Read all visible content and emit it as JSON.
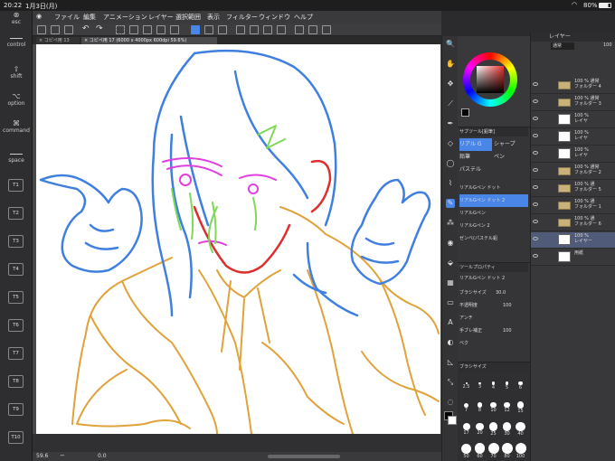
{
  "status": {
    "time": "20:22",
    "date": "1月3日(月)",
    "battery": "80%"
  },
  "menu": [
    "ファイル",
    "編集",
    "アニメーション",
    "レイヤー",
    "選択範囲",
    "表示",
    "フィルター",
    "ウィンドウ",
    "ヘルプ"
  ],
  "left_keys": {
    "esc": "esc",
    "control": "control",
    "shift": "shift",
    "option": "option",
    "command": "command",
    "space": "space"
  },
  "fkeys": [
    "T1",
    "T2",
    "T3",
    "T4",
    "T5",
    "T6",
    "T7",
    "T8",
    "T9",
    "T10"
  ],
  "tabs": [
    "コピペ用 13",
    "コピペ用 17 (6000 x 4000px 600dpi 59.6%)"
  ],
  "zoom": "59.6",
  "rotation": "0.0",
  "layer_panel": {
    "title": "レイヤー",
    "blend_mode": "通常",
    "opacity": "100",
    "layers": [
      {
        "text": "100 % 通常\nフォルダー 4",
        "folder": true
      },
      {
        "text": "100 % 通常\nフォルダー 3",
        "folder": true
      },
      {
        "text": "100 %\nレイヤ",
        "folder": false
      },
      {
        "text": "100 %\nレイヤ",
        "folder": false
      },
      {
        "text": "100 %\nレイヤ",
        "folder": false
      },
      {
        "text": "100 % 通常\nフォルダー 2",
        "folder": true
      },
      {
        "text": "100 % 通\nフォルダー 5",
        "folder": true
      },
      {
        "text": "100 % 通\nフォルダー 1",
        "folder": true
      },
      {
        "text": "100 % 通\nフォルダー 6",
        "folder": true
      },
      {
        "text": "100 %\nレイヤー",
        "folder": false,
        "selected": true
      },
      {
        "text": "用紙",
        "folder": false
      }
    ]
  },
  "subtool": {
    "title": "サブツール[鉛筆]",
    "groups": [
      "リアル G",
      "シャープ",
      "鉛筆",
      "ペン",
      "パステル"
    ],
    "brushes": [
      "リアルGペン ドット",
      "リアルGペン ドット 2",
      "リアルGペン",
      "リアルGペン 2",
      "ゼンベ(パステル鉛"
    ]
  },
  "toolprop": {
    "title": "ツールプロパティ",
    "brush_name": "リアルGペン ドット 2",
    "size_label": "ブラシサイズ",
    "size_value": "30.0",
    "opacity_label": "不透明度",
    "opacity_value": "100",
    "aa_label": "アンチ",
    "stab_label": "手ブレ補正",
    "stab_value": "100",
    "vector_label": "ベク"
  },
  "brushsize": {
    "title": "ブラシサイズ",
    "values": [
      "2.5",
      "3",
      "4",
      "5",
      "6",
      "7",
      "8",
      "10",
      "12",
      "15",
      "17",
      "20",
      "25",
      "30",
      "40",
      "50",
      "60",
      "70",
      "80",
      "100"
    ]
  },
  "colors": {
    "orange": "#e0a23a",
    "blue": "#3f7fe0",
    "red": "#dd2f2f",
    "green": "#7ed957",
    "magenta": "#e23fe0",
    "accent": "#4a86e8"
  }
}
